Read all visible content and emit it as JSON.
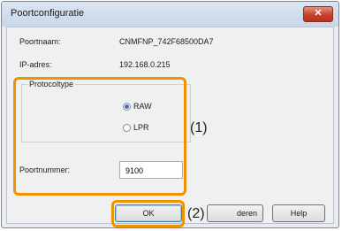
{
  "window": {
    "title": "Poortconfiguratie",
    "close_label": "✕"
  },
  "fields": {
    "port_name_label": "Poortnaam:",
    "port_name_value": "CNMFNP_742F68500DA7",
    "ip_label": "IP-adres:",
    "ip_value": "192.168.0.215",
    "protocol_group_label": "Protocoltype",
    "protocol_options": [
      {
        "label": "RAW",
        "checked": true
      },
      {
        "label": "LPR",
        "checked": false
      }
    ],
    "port_number_label": "Poortnummer:",
    "port_number_value": "9100"
  },
  "buttons": {
    "ok": "OK",
    "cancel_partial": "deren",
    "help": "Help"
  },
  "annotations": {
    "one": "(1)",
    "two": "(2)"
  },
  "colors": {
    "highlight": "#f39200",
    "close_button": "#c6412e"
  }
}
